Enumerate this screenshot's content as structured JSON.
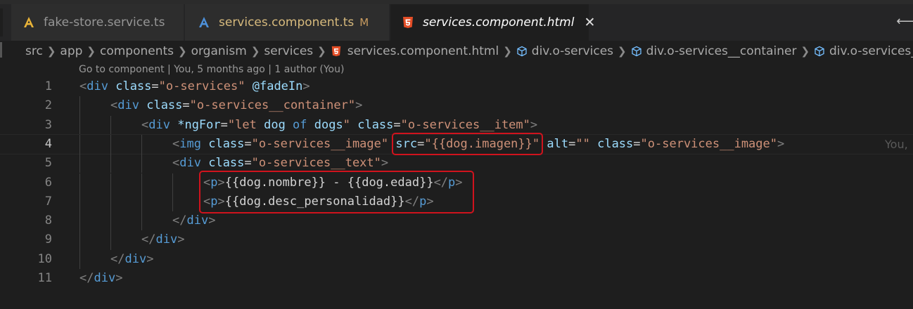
{
  "tabs": [
    {
      "label": "fake-store.service.ts",
      "icon": "angular-service-icon",
      "modified": "",
      "active": false
    },
    {
      "label": "services.component.ts",
      "icon": "angular-component-icon",
      "modified": "M",
      "active": false
    },
    {
      "label": "services.component.html",
      "icon": "html5-icon",
      "modified": "",
      "active": true,
      "close": "✕"
    }
  ],
  "breadcrumb": [
    "src",
    "app",
    "components",
    "organism",
    "services",
    "services.component.html",
    "div.o-services",
    "div.o-services__container",
    "div.o-services__ite"
  ],
  "codelens": "Go to component | You, 5 months ago | 1 author (You)",
  "lines": [
    {
      "num": "1",
      "indent": 0,
      "tokens": [
        {
          "t": "<",
          "c": "punc"
        },
        {
          "t": "div",
          "c": "tag"
        },
        {
          "t": " "
        },
        {
          "t": "class",
          "c": "attr"
        },
        {
          "t": "=",
          "c": "text"
        },
        {
          "t": "\"o-services\"",
          "c": "str"
        },
        {
          "t": " "
        },
        {
          "t": "@fadeIn",
          "c": "attr"
        },
        {
          "t": ">",
          "c": "punc"
        }
      ]
    },
    {
      "num": "2",
      "indent": 1,
      "tokens": [
        {
          "t": "<",
          "c": "punc"
        },
        {
          "t": "div",
          "c": "tag"
        },
        {
          "t": " "
        },
        {
          "t": "class",
          "c": "attr"
        },
        {
          "t": "=",
          "c": "text"
        },
        {
          "t": "\"o-services__container\"",
          "c": "str"
        },
        {
          "t": ">",
          "c": "punc"
        }
      ]
    },
    {
      "num": "3",
      "indent": 2,
      "tokens": [
        {
          "t": "<",
          "c": "punc"
        },
        {
          "t": "div",
          "c": "tag"
        },
        {
          "t": " "
        },
        {
          "t": "*ngFor",
          "c": "attr"
        },
        {
          "t": "=",
          "c": "text"
        },
        {
          "t": "\"",
          "c": "str"
        },
        {
          "t": "let ",
          "c": "str"
        },
        {
          "t": "dog ",
          "c": "attr"
        },
        {
          "t": "of ",
          "c": "kw"
        },
        {
          "t": "dogs",
          "c": "attr"
        },
        {
          "t": "\"",
          "c": "str"
        },
        {
          "t": " "
        },
        {
          "t": "class",
          "c": "attr"
        },
        {
          "t": "=",
          "c": "text"
        },
        {
          "t": "\"o-services__item\"",
          "c": "str"
        },
        {
          "t": ">",
          "c": "punc"
        }
      ]
    },
    {
      "num": "4",
      "indent": 3,
      "current": true,
      "tokens": [
        {
          "t": "<",
          "c": "punc"
        },
        {
          "t": "img",
          "c": "tag"
        },
        {
          "t": " "
        },
        {
          "t": "class",
          "c": "attr"
        },
        {
          "t": "=",
          "c": "text"
        },
        {
          "t": "\"o-services__image\"",
          "c": "str"
        },
        {
          "t": " "
        },
        {
          "t": "src",
          "c": "attr"
        },
        {
          "t": "=",
          "c": "text"
        },
        {
          "t": "\"",
          "c": "str"
        },
        {
          "t": "{{dog.imagen}}",
          "c": "str"
        },
        {
          "t": "\"",
          "c": "str"
        },
        {
          "t": " "
        },
        {
          "t": "alt",
          "c": "attr"
        },
        {
          "t": "=",
          "c": "text"
        },
        {
          "t": "\"\"",
          "c": "str"
        },
        {
          "t": " "
        },
        {
          "t": "class",
          "c": "attr"
        },
        {
          "t": "=",
          "c": "text"
        },
        {
          "t": "\"o-services__image\"",
          "c": "str"
        },
        {
          "t": ">",
          "c": "punc"
        }
      ],
      "blame": "You,"
    },
    {
      "num": "5",
      "indent": 3,
      "tokens": [
        {
          "t": "<",
          "c": "punc"
        },
        {
          "t": "div",
          "c": "tag"
        },
        {
          "t": " "
        },
        {
          "t": "class",
          "c": "attr"
        },
        {
          "t": "=",
          "c": "text"
        },
        {
          "t": "\"o-services__text\"",
          "c": "str"
        },
        {
          "t": ">",
          "c": "punc"
        }
      ]
    },
    {
      "num": "6",
      "indent": 4,
      "tokens": [
        {
          "t": "<",
          "c": "punc"
        },
        {
          "t": "p",
          "c": "tag"
        },
        {
          "t": ">",
          "c": "punc"
        },
        {
          "t": "{{dog.nombre}} - {{dog.edad}}",
          "c": "text"
        },
        {
          "t": "</",
          "c": "punc"
        },
        {
          "t": "p",
          "c": "tag"
        },
        {
          "t": ">",
          "c": "punc"
        }
      ]
    },
    {
      "num": "7",
      "indent": 4,
      "tokens": [
        {
          "t": "<",
          "c": "punc"
        },
        {
          "t": "p",
          "c": "tag"
        },
        {
          "t": ">",
          "c": "punc"
        },
        {
          "t": "{{dog.desc_personalidad}}",
          "c": "text"
        },
        {
          "t": "</",
          "c": "punc"
        },
        {
          "t": "p",
          "c": "tag"
        },
        {
          "t": ">",
          "c": "punc"
        }
      ]
    },
    {
      "num": "8",
      "indent": 3,
      "tokens": [
        {
          "t": "</",
          "c": "punc"
        },
        {
          "t": "div",
          "c": "tag"
        },
        {
          "t": ">",
          "c": "punc"
        }
      ]
    },
    {
      "num": "9",
      "indent": 2,
      "tokens": [
        {
          "t": "</",
          "c": "punc"
        },
        {
          "t": "div",
          "c": "tag"
        },
        {
          "t": ">",
          "c": "punc"
        }
      ]
    },
    {
      "num": "10",
      "indent": 1,
      "tokens": [
        {
          "t": "</",
          "c": "punc"
        },
        {
          "t": "div",
          "c": "tag"
        },
        {
          "t": ">",
          "c": "punc"
        }
      ]
    },
    {
      "num": "11",
      "indent": 0,
      "tokens": [
        {
          "t": "</",
          "c": "punc"
        },
        {
          "t": "div",
          "c": "tag"
        },
        {
          "t": ">",
          "c": "punc"
        }
      ]
    }
  ],
  "highlights": [
    {
      "name": "src-binding-highlight",
      "line": 4
    },
    {
      "name": "paragraph-bindings-highlight",
      "lines": [
        6,
        7
      ]
    }
  ],
  "colors": {
    "background": "#1e1e1e",
    "tag": "#569cd6",
    "attribute": "#9cdcfe",
    "string": "#ce9178",
    "highlight_box": "#d0131d",
    "modified": "#c89b60"
  }
}
